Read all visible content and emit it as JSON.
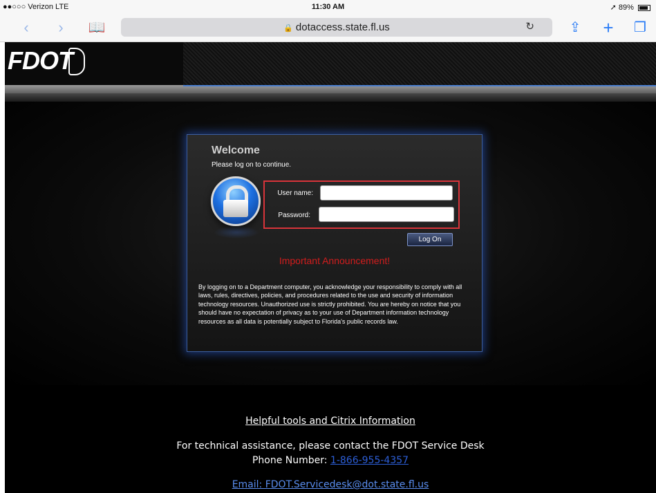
{
  "status_bar": {
    "carrier": "●●○○○ Verizon  LTE",
    "time": "11:30 AM",
    "battery": "89%"
  },
  "browser": {
    "url": "dotaccess.state.fl.us",
    "icons": [
      "back-icon",
      "forward-icon",
      "bookmarks-icon",
      "lock-icon",
      "reload-icon",
      "share-icon",
      "new-tab-icon",
      "tabs-icon"
    ],
    "accent_color": "#2a7cf6"
  },
  "header": {
    "logo_text": "FDOT"
  },
  "login": {
    "title": "Welcome",
    "subtitle": "Please log on to continue.",
    "username_label": "User name:",
    "password_label": "Password:",
    "username_value": "",
    "password_value": "",
    "logon_button": "Log On",
    "announcement": "Important Announcement!",
    "disclaimer": "By logging on to a Department computer, you acknowledge your responsibility to comply with all laws, rules, directives, policies, and procedures related to the use and security of information technology resources. Unauthorized use is strictly prohibited. You are hereby on notice that you should have no expectation of privacy as to your use of Department information technology resources as all data is potentially subject to Florida's public records law.",
    "highlight_color": "#d9343a",
    "announcement_color": "#d21d1d"
  },
  "footer": {
    "helpful_link": "Helpful tools and Citrix Information",
    "assist_text": "For technical assistance, please contact the FDOT Service Desk",
    "phone_label": "Phone Number: ",
    "phone_number": "1-866-955-4357",
    "email_link": "Email: FDOT.Servicedesk@dot.state.fl.us"
  }
}
